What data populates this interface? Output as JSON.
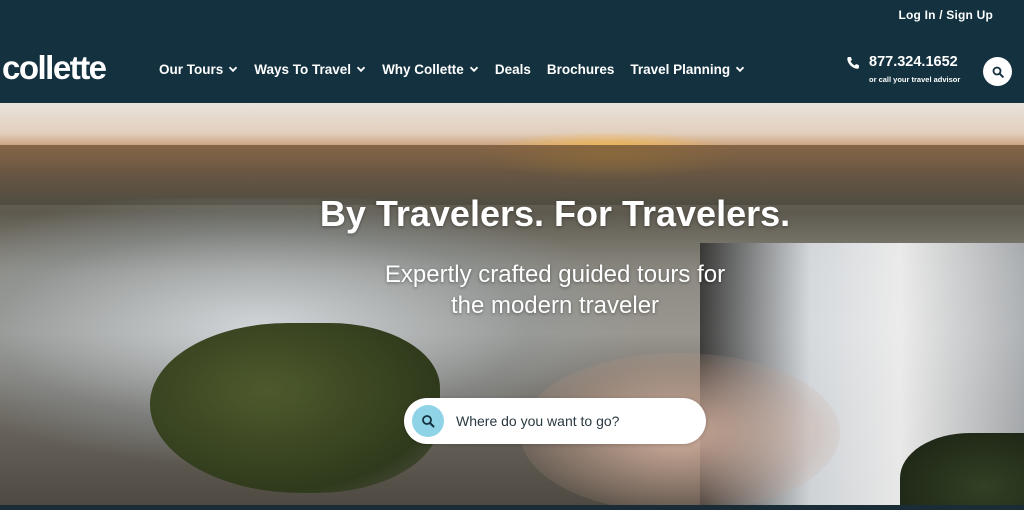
{
  "header": {
    "login_label": "Log In / Sign Up",
    "logo_text": "collette",
    "phone_number": "877.324.1652",
    "phone_note": "or call your travel advisor",
    "search_icon": "search-icon",
    "phone_icon": "phone-icon"
  },
  "nav": {
    "items": [
      {
        "label": "Our Tours",
        "has_dropdown": true
      },
      {
        "label": "Ways To Travel",
        "has_dropdown": true
      },
      {
        "label": "Why Collette",
        "has_dropdown": true
      },
      {
        "label": "Deals",
        "has_dropdown": false
      },
      {
        "label": "Brochures",
        "has_dropdown": false
      },
      {
        "label": "Travel Planning",
        "has_dropdown": true
      }
    ]
  },
  "hero": {
    "title": "By Travelers. For Travelers.",
    "subtitle": "Expertly crafted guided tours for the modern traveler",
    "search_placeholder": "Where do you want to go?"
  },
  "colors": {
    "header_bg": "#13313f",
    "search_icon_bg": "#8fd3e6",
    "text_light": "#ffffff"
  }
}
